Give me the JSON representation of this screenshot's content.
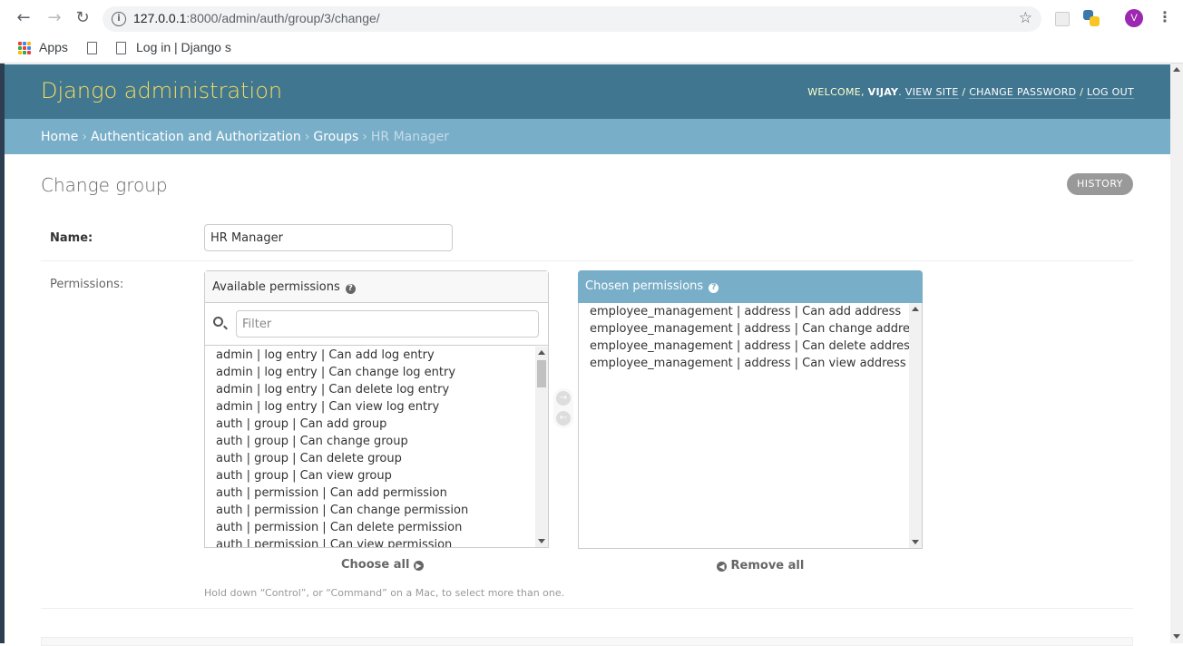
{
  "browser": {
    "url_host": "127.0.0.1",
    "url_rest": ":8000/admin/auth/group/3/change/",
    "bookmarks": [
      {
        "label": "Apps"
      },
      {
        "label": ""
      },
      {
        "label": "Log in | Django s"
      }
    ],
    "profile_initial": "V",
    "colors": {
      "avatar": "#9c27b0"
    }
  },
  "header": {
    "branding": "Django administration",
    "welcome": "WELCOME, ",
    "username": "VIJAY",
    "welcome_end": ".",
    "view_site": "VIEW SITE",
    "change_password": "CHANGE PASSWORD",
    "log_out": "LOG OUT",
    "separator": " / ",
    "colors": {
      "header_bg": "#417690",
      "branding": "#f5dd5d",
      "breadcrumb_bg": "#79aec8"
    }
  },
  "breadcrumbs": {
    "home": "Home",
    "app": "Authentication and Authorization",
    "model": "Groups",
    "current": "HR Manager",
    "sep": "›"
  },
  "page": {
    "title": "Change group",
    "history_label": "HISTORY"
  },
  "form": {
    "name_label": "Name:",
    "name_value": "HR Manager",
    "permissions_label": "Permissions:",
    "available_title": "Available permissions",
    "filter_placeholder": "Filter",
    "available": [
      "admin | log entry | Can add log entry",
      "admin | log entry | Can change log entry",
      "admin | log entry | Can delete log entry",
      "admin | log entry | Can view log entry",
      "auth | group | Can add group",
      "auth | group | Can change group",
      "auth | group | Can delete group",
      "auth | group | Can view group",
      "auth | permission | Can add permission",
      "auth | permission | Can change permission",
      "auth | permission | Can delete permission",
      "auth | permission | Can view permission"
    ],
    "chosen_title": "Chosen permissions",
    "chosen": [
      "employee_management | address | Can add address",
      "employee_management | address | Can change address",
      "employee_management | address | Can delete address",
      "employee_management | address | Can view address"
    ],
    "choose_all": "Choose all",
    "remove_all": "Remove all",
    "help_text": "Hold down “Control”, or “Command” on a Mac, to select more than one."
  }
}
